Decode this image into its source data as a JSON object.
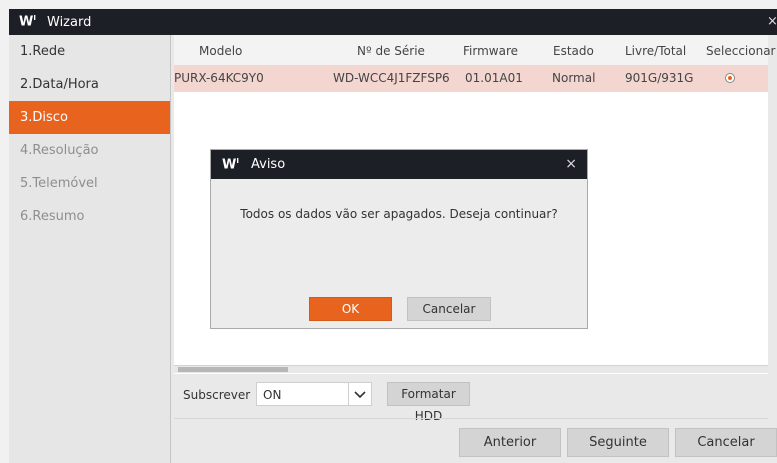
{
  "window": {
    "logo": "W",
    "title": "Wizard",
    "close_glyph": "×"
  },
  "sidebar": {
    "items": [
      {
        "label": "1.Rede",
        "state": "normal"
      },
      {
        "label": "2.Data/Hora",
        "state": "normal"
      },
      {
        "label": "3.Disco",
        "state": "active"
      },
      {
        "label": "4.Resolução",
        "state": "disabled"
      },
      {
        "label": "5.Telemóvel",
        "state": "disabled"
      },
      {
        "label": "6.Resumo",
        "state": "disabled"
      }
    ]
  },
  "table": {
    "columns": [
      "Modelo",
      "Nº de Série",
      "Firmware",
      "Estado",
      "Livre/Total",
      "Seleccionar"
    ],
    "rows": [
      {
        "modelo": "PURX-64KC9Y0",
        "serie": "WD-WCC4J1FZFSP6",
        "firmware": "01.01A01",
        "estado": "Normal",
        "livre_total": "901G/931G",
        "selected": true
      }
    ]
  },
  "controls": {
    "subscrever_label": "Subscrever",
    "subscrever_value": "ON",
    "format_button": "Formatar HDD"
  },
  "footer": {
    "anterior": "Anterior",
    "seguinte": "Seguinte",
    "cancelar": "Cancelar"
  },
  "dialog": {
    "logo": "W",
    "title": "Aviso",
    "close_glyph": "×",
    "message": "Todos os dados vão ser apagados. Deseja continuar?",
    "ok": "OK",
    "cancel": "Cancelar"
  },
  "colors": {
    "accent": "#e8641e",
    "titlebar": "#1c1f26",
    "selected_row": "#f3d6cf"
  },
  "icons": {
    "dropdown": "chevron-down-icon",
    "radio": "radio-selected-icon"
  }
}
